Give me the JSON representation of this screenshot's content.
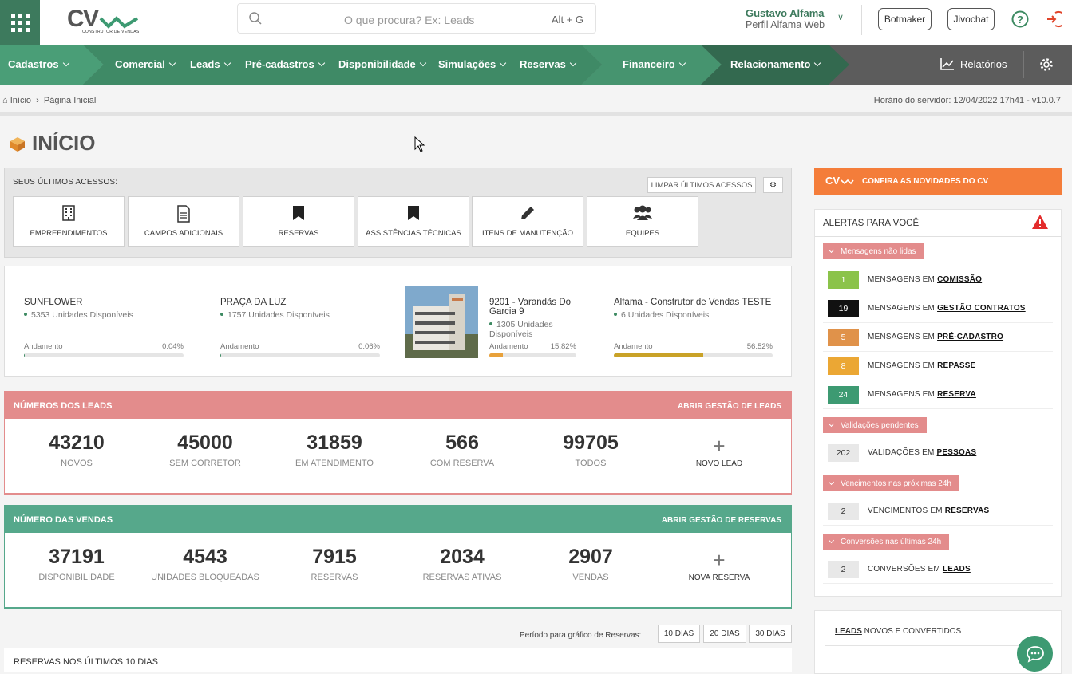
{
  "header": {
    "search_placeholder": "O que procura? Ex: Leads",
    "search_shortcut": "Alt + G",
    "user_name": "Gustavo Alfama",
    "user_profile": "Perfil Alfama Web",
    "botmaker_label": "Botmaker",
    "jivochat_label": "Jivochat",
    "logo_sub": "CONSTRUTOR DE VENDAS"
  },
  "nav": {
    "items": [
      "Cadastros",
      "Comercial",
      "Leads",
      "Pré-cadastros",
      "Disponibilidade",
      "Simulações",
      "Reservas",
      "Financeiro",
      "Relacionamento"
    ],
    "reports_label": "Relatórios"
  },
  "breadcrumb": {
    "home": "Início",
    "current": "Página Inicial",
    "server_time": "Horário do servidor: 12/04/2022 17h41 - v10.0.7"
  },
  "page_title": "INÍCIO",
  "recent": {
    "label": "SEUS ÚLTIMOS ACESSOS:",
    "clear_label": "LIMPAR ÚLTIMOS ACESSOS",
    "tiles": [
      {
        "label": "EMPREENDIMENTOS",
        "icon": "building-icon"
      },
      {
        "label": "CAMPOS ADICIONAIS",
        "icon": "document-icon"
      },
      {
        "label": "RESERVAS",
        "icon": "bookmark-icon"
      },
      {
        "label": "ASSISTÊNCIAS TÉCNICAS",
        "icon": "bookmark-icon"
      },
      {
        "label": "ITENS DE MANUTENÇÃO",
        "icon": "pencil-icon"
      },
      {
        "label": "EQUIPES",
        "icon": "users-icon"
      }
    ]
  },
  "projects": [
    {
      "name": "SUNFLOWER",
      "available": "5353 Unidades Disponíveis",
      "progress_label": "Andamento",
      "progress_text": "0.04%",
      "progress": 0.04,
      "bar_color": "#3d8a62"
    },
    {
      "name": "PRAÇA DA LUZ",
      "available": "1757 Unidades Disponíveis",
      "progress_label": "Andamento",
      "progress_text": "0.06%",
      "progress": 0.06,
      "bar_color": "#3d8a62"
    },
    {
      "name": "9201 - Varandãs Do Garcia 9",
      "available": "1305 Unidades Disponíveis",
      "progress_label": "Andamento",
      "progress_text": "15.82%",
      "progress": 15.82,
      "bar_color": "#e8a13a"
    },
    {
      "name": "Alfama - Construtor de Vendas TESTE",
      "available": "6 Unidades Disponíveis",
      "progress_label": "Andamento",
      "progress_text": "56.52%",
      "progress": 56.52,
      "bar_color": "#c9a227"
    }
  ],
  "leads": {
    "title": "NÚMEROS DOS LEADS",
    "action": "ABRIR GESTÃO DE LEADS",
    "stats": [
      {
        "value": "43210",
        "label": "NOVOS"
      },
      {
        "value": "45000",
        "label": "SEM CORRETOR"
      },
      {
        "value": "31859",
        "label": "EM ATENDIMENTO"
      },
      {
        "value": "566",
        "label": "COM RESERVA"
      },
      {
        "value": "99705",
        "label": "TODOS"
      }
    ],
    "add_label": "NOVO LEAD",
    "color": "#e38c8c"
  },
  "sales": {
    "title": "NÚMERO DAS VENDAS",
    "action": "ABRIR GESTÃO DE RESERVAS",
    "stats": [
      {
        "value": "37191",
        "label": "DISPONIBILIDADE"
      },
      {
        "value": "4543",
        "label": "UNIDADES BLOQUEADAS"
      },
      {
        "value": "7915",
        "label": "RESERVAS"
      },
      {
        "value": "2034",
        "label": "RESERVAS ATIVAS"
      },
      {
        "value": "2907",
        "label": "VENDAS"
      }
    ],
    "add_label": "NOVA RESERVA",
    "color": "#56a88b"
  },
  "period": {
    "label": "Período para gráfico de Reservas:",
    "options": [
      "10 DIAS",
      "20 DIAS",
      "30 DIAS"
    ]
  },
  "reservas_chart_title": "RESERVAS NOS ÚLTIMOS 10 DIAS",
  "news_label": "CONFIRA AS NOVIDADES DO CV",
  "alerts": {
    "title": "ALERTAS PARA VOCÊ",
    "groups": [
      {
        "tag": "Mensagens não lidas",
        "rows": [
          {
            "count": "1",
            "prefix": "MENSAGENS EM ",
            "link": "COMISSÃO",
            "color": "#8bc34a"
          },
          {
            "count": "19",
            "prefix": "MENSAGENS EM ",
            "link": "GESTÃO CONTRATOS",
            "color": "#111111"
          },
          {
            "count": "5",
            "prefix": "MENSAGENS EM ",
            "link": "PRÉ-CADASTRO",
            "color": "#e0924a"
          },
          {
            "count": "8",
            "prefix": "MENSAGENS EM ",
            "link": "REPASSE",
            "color": "#eba734"
          },
          {
            "count": "24",
            "prefix": "MENSAGENS EM ",
            "link": "RESERVA",
            "color": "#3d9a72"
          }
        ]
      },
      {
        "tag": "Validações pendentes",
        "rows": [
          {
            "count": "202",
            "prefix": "VALIDAÇÕES EM ",
            "link": "PESSOAS",
            "color": "#e8e8e8"
          }
        ]
      },
      {
        "tag": "Vencimentos nas próximas 24h",
        "rows": [
          {
            "count": "2",
            "prefix": "VENCIMENTOS EM ",
            "link": "RESERVAS",
            "color": "#e8e8e8"
          }
        ]
      },
      {
        "tag": "Conversões nas últimas 24h",
        "rows": [
          {
            "count": "2",
            "prefix": "CONVERSÕES EM ",
            "link": "LEADS",
            "color": "#e8e8e8"
          }
        ]
      }
    ]
  },
  "leads_box": {
    "link": "LEADS",
    "text": " NOVOS E CONVERTIDOS"
  }
}
